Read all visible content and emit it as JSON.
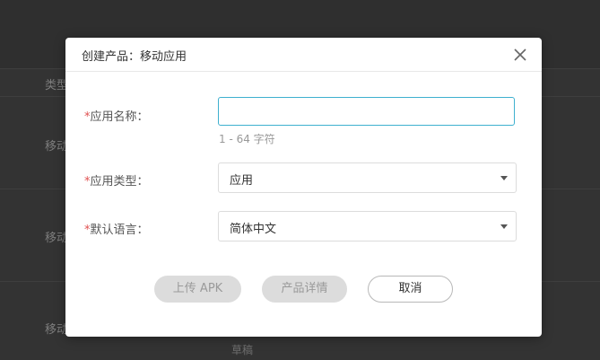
{
  "background": {
    "header_label": "类型",
    "rows": [
      "移动",
      "移动",
      "移动"
    ],
    "status_text": "草稿"
  },
  "modal": {
    "title": "创建产品：移动应用",
    "close_icon": "close-icon",
    "form": {
      "required_mark": "*",
      "app_name": {
        "label": "应用名称：",
        "value": "",
        "hint": "1 - 64 字符"
      },
      "app_type": {
        "label": "应用类型：",
        "value": "应用"
      },
      "default_language": {
        "label": "默认语言：",
        "value": "简体中文"
      }
    },
    "buttons": {
      "upload_apk": "上传 APK",
      "product_details": "产品详情",
      "cancel": "取消"
    }
  },
  "colors": {
    "accent_border": "#3eb0cf",
    "required": "#e05050",
    "overlay": "#343434"
  }
}
